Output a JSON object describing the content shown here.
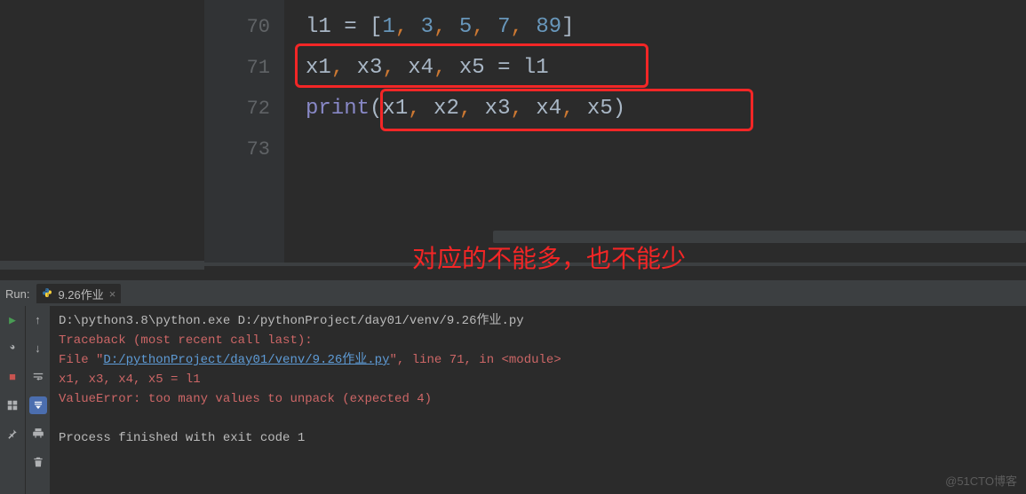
{
  "editor": {
    "lines": {
      "70": {
        "no": "70"
      },
      "71": {
        "no": "71"
      },
      "72": {
        "no": "72"
      },
      "73": {
        "no": "73"
      }
    },
    "code70": {
      "v": "l1",
      "eq": " = ",
      "lb": "[",
      "n1": "1",
      "c": ", ",
      "n2": "3",
      "n3": "5",
      "n4": "7",
      "n5": "89",
      "rb": "]"
    },
    "code71": {
      "x1": "x1",
      "c": ", ",
      "x3": "x3",
      "x4": "x4",
      "x5": "x5",
      "eq": " = ",
      "rhs": "l1"
    },
    "code72": {
      "fn": "print",
      "lp": "(",
      "x1": "x1",
      "c": ", ",
      "x2": "x2",
      "x3": "x3",
      "x4": "x4",
      "x5": "x5",
      "rp": ")"
    }
  },
  "annotation": {
    "text": "对应的不能多，也不能少"
  },
  "run": {
    "label": "Run:",
    "tab_name": "9.26作业",
    "tab_close": "×",
    "console_lines": {
      "l1": "D:\\python3.8\\python.exe D:/pythonProject/day01/venv/9.26作业.py",
      "l2": "Traceback (most recent call last):",
      "l3a": "  File \"",
      "l3_link": "D:/pythonProject/day01/venv/9.26作业.py",
      "l3b": "\", line 71, in <module>",
      "l4": "    x1, x3, x4, x5 = l1",
      "l5": "ValueError: too many values to unpack (expected 4)",
      "l6": "Process finished with exit code 1"
    }
  },
  "watermark": "@51CTO博客"
}
